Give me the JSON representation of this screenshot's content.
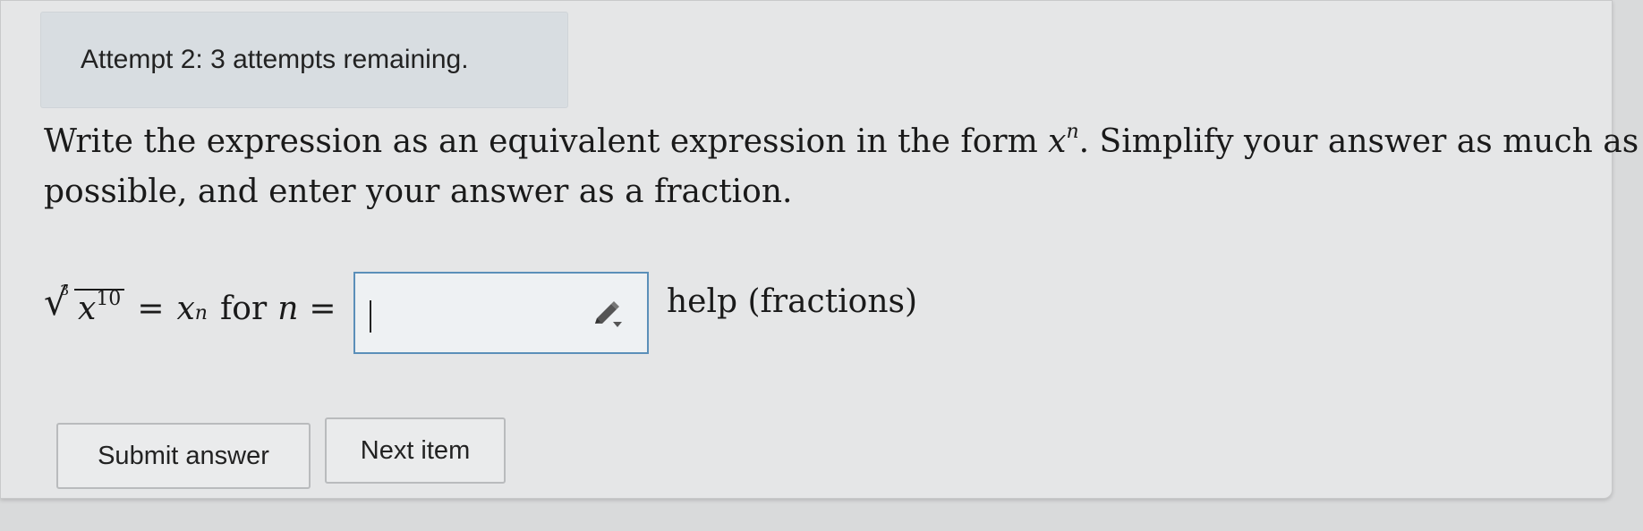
{
  "attempt": {
    "text": "Attempt 2: 3 attempts remaining."
  },
  "question": {
    "line1_pre": "Write the expression as an equivalent expression in the form ",
    "line1_var": "x",
    "line1_exp": "n",
    "line1_post": ". Simplify your answer as much as",
    "line2": "possible, and enter your answer as a fraction."
  },
  "equation": {
    "root_index": "3",
    "radicand_base": "x",
    "radicand_exp": "10",
    "equals": "=",
    "rhs_base": "x",
    "rhs_exp": "n",
    "for_text": "for",
    "n_var": "n",
    "equals2": "="
  },
  "answer": {
    "value": "",
    "placeholder": ""
  },
  "help": {
    "label": "help (fractions)"
  },
  "buttons": {
    "submit": "Submit answer",
    "next": "Next item"
  },
  "icons": {
    "editor": "pencil-dropdown-icon"
  },
  "colors": {
    "input_border": "#5b8fb9",
    "banner_bg": "#d8dde1"
  }
}
